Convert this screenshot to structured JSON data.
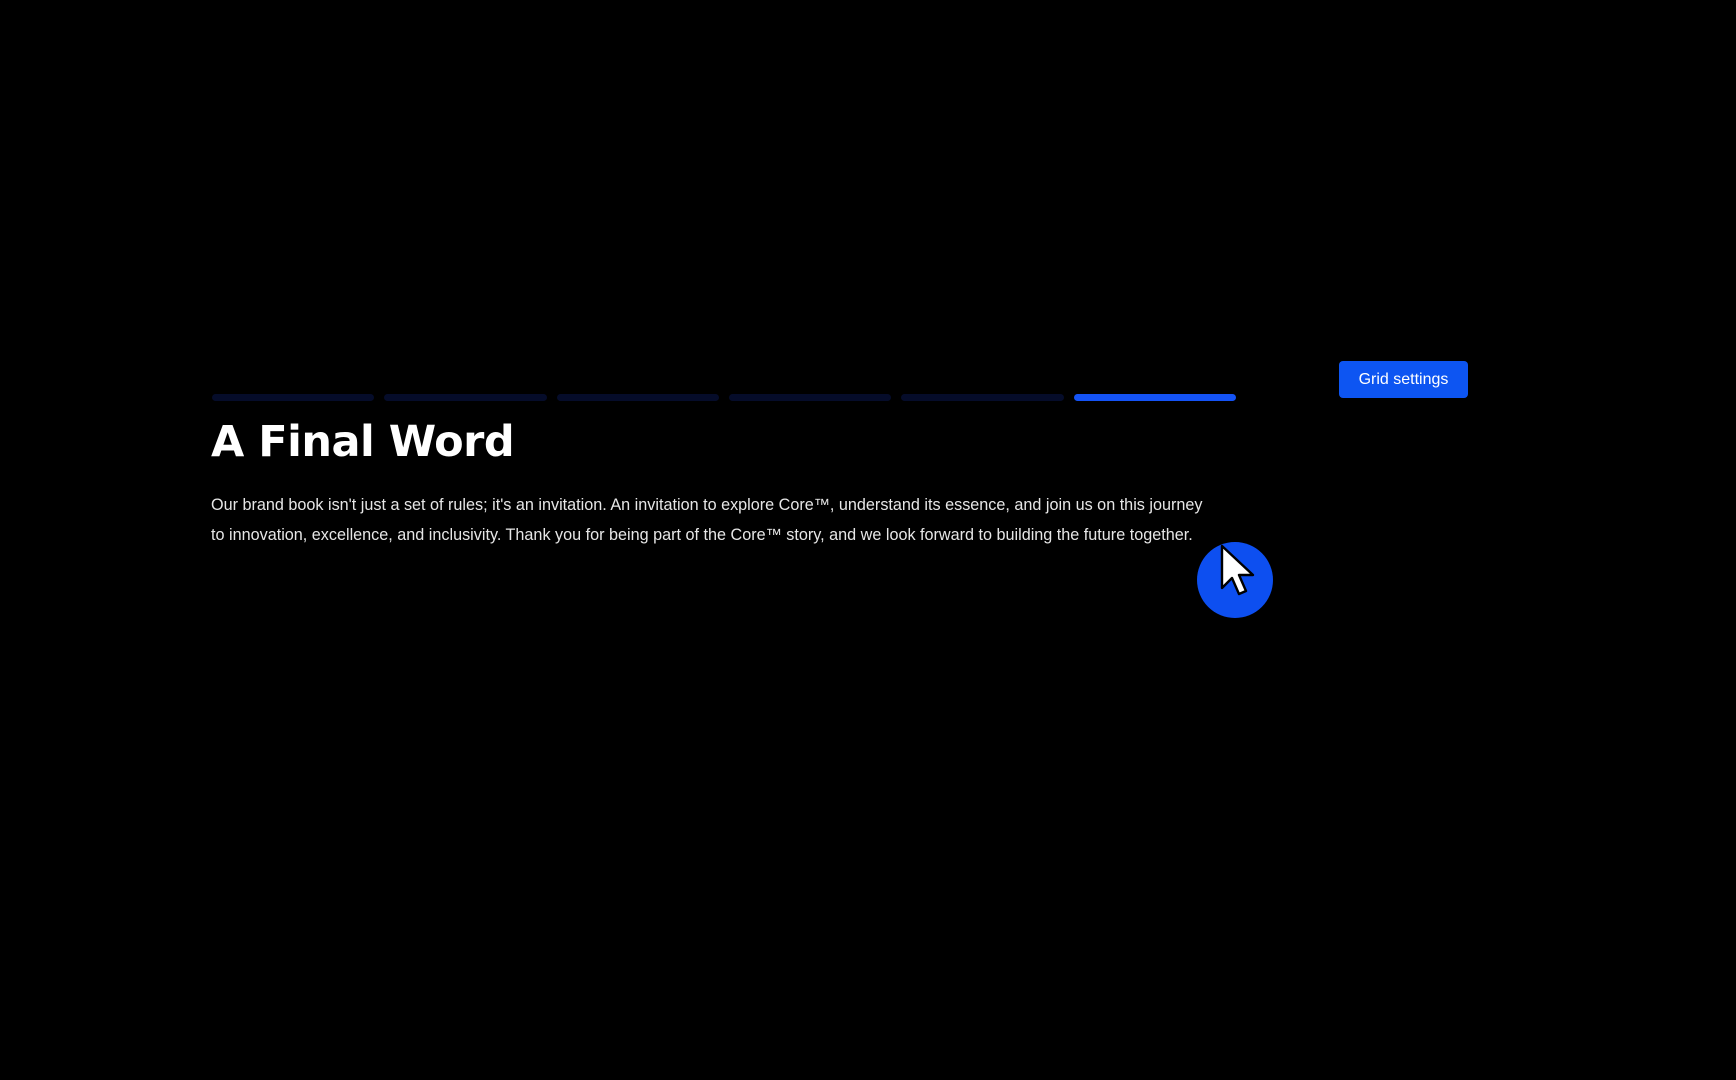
{
  "toolbar": {
    "grid_settings_label": "Grid settings"
  },
  "progress": {
    "segments": 6,
    "active_index": 6
  },
  "content": {
    "title": "A Final Word",
    "body": "Our brand book isn't just a set of rules; it's an invitation. An invitation to explore Core™, understand its essence, and join us on this journey to innovation, excellence, and inclusivity. Thank you for being part of the Core™ story, and we look forward to building the future together."
  },
  "cursor": {
    "icon": "pointer-cursor-icon"
  },
  "colors": {
    "background": "#000000",
    "accent": "#1453f5",
    "inactive_segment": "#050c2a",
    "text": "#ffffff"
  }
}
